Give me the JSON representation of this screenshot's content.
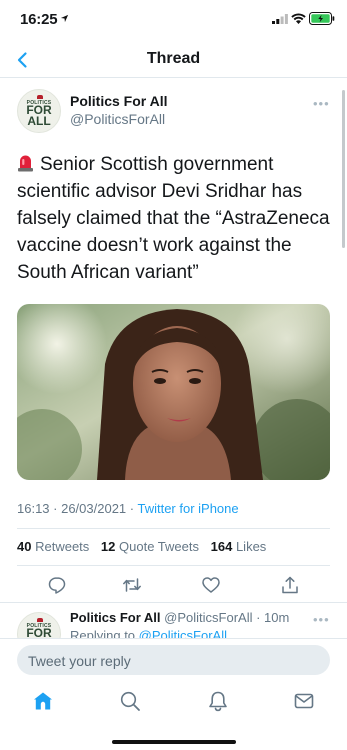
{
  "status": {
    "time": "16:25"
  },
  "nav": {
    "title": "Thread"
  },
  "author": {
    "name": "Politics For All",
    "handle": "@PoliticsForAll",
    "avatar_small_text": "POLITICS",
    "avatar_big_text_1": "FOR",
    "avatar_big_text_2": "ALL"
  },
  "tweet": {
    "text": "Senior Scottish government scientific advisor Devi Sridhar has falsely claimed that the “AstraZeneca vaccine doesn’t work against the South African variant”",
    "timestamp": "16:13 · 26/03/2021 · ",
    "source": "Twitter for iPhone",
    "retweets": "40",
    "retweets_label": "Retweets",
    "quotes": "12",
    "quotes_label": "Quote Tweets",
    "likes": "164",
    "likes_label": "Likes"
  },
  "reply": {
    "name": "Politics For All",
    "meta": "@PoliticsForAll · 10m",
    "replying_label": "Replying to",
    "replying_to": "@PoliticsForAll"
  },
  "composer": {
    "placeholder": "Tweet your reply"
  },
  "colors": {
    "accent": "#1da1f2",
    "text": "#14171a",
    "muted": "#657786"
  },
  "icons": [
    "back-chevron-icon",
    "siren-emoji-icon",
    "reply-icon",
    "retweet-icon",
    "like-icon",
    "share-icon",
    "home-icon",
    "search-icon",
    "notifications-icon",
    "messages-icon"
  ]
}
